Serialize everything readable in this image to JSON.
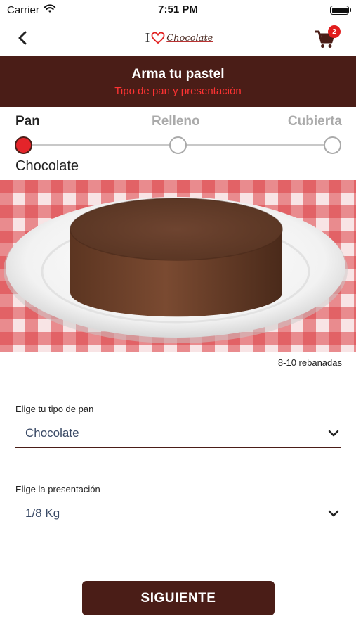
{
  "status": {
    "carrier": "Carrier",
    "time": "7:51 PM"
  },
  "nav": {
    "logo_i": "I",
    "logo_word": "Chocolate",
    "cart_count": "2"
  },
  "banner": {
    "title": "Arma tu pastel",
    "subtitle": "Tipo de pan y presentación"
  },
  "stepper": {
    "steps": [
      {
        "label": "Pan",
        "state": "active"
      },
      {
        "label": "Relleno",
        "state": "inactive"
      },
      {
        "label": "Cubierta",
        "state": "inactive"
      }
    ],
    "selected_name": "Chocolate"
  },
  "product": {
    "slices": "8-10 rebanadas"
  },
  "form": {
    "bread_label": "Elige tu tipo de pan",
    "bread_value": "Chocolate",
    "presentation_label": "Elige la presentación",
    "presentation_value": "1/8 Kg"
  },
  "actions": {
    "next_label": "SIGUIENTE"
  },
  "colors": {
    "brand_brown": "#4a1d17",
    "accent_red": "#e4242a",
    "badge_red": "#e11d1d"
  },
  "icons": {
    "back": "chevron-left-icon",
    "cart": "cart-icon",
    "wifi": "wifi-icon",
    "battery": "battery-icon",
    "dropdown": "chevron-down-icon"
  }
}
